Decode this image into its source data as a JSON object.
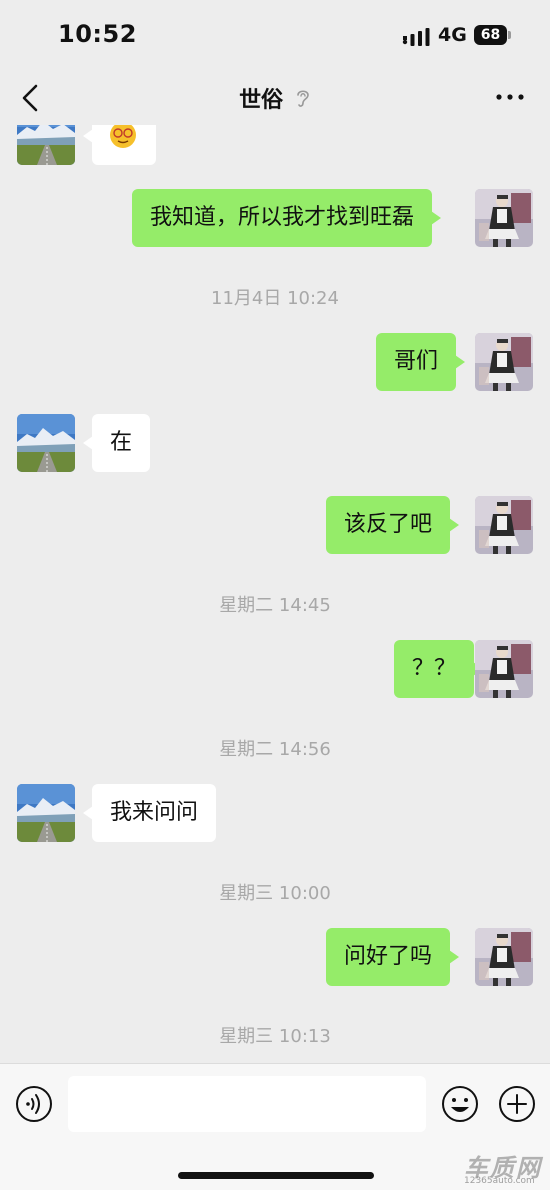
{
  "status_bar": {
    "time": "10:52",
    "network": "4G",
    "battery": "68"
  },
  "header": {
    "title": "世俗",
    "back_icon": "chevron-left-icon",
    "mute_icon": "ear-muted-icon",
    "more_icon": "ellipsis-icon"
  },
  "messages": [
    {
      "side": "in",
      "type": "sticker",
      "sticker": "yellow-face-sticker"
    },
    {
      "side": "out",
      "type": "text",
      "text": "我知道，所以我才找到旺磊"
    },
    {
      "type": "time",
      "text": "11月4日 10:24"
    },
    {
      "side": "out",
      "type": "text",
      "text": "哥们"
    },
    {
      "side": "in",
      "type": "text",
      "text": "在"
    },
    {
      "side": "out",
      "type": "text",
      "text": "该反了吧"
    },
    {
      "type": "time",
      "text": "星期二 14:45"
    },
    {
      "side": "out",
      "type": "text",
      "text": "？？"
    },
    {
      "type": "time",
      "text": "星期二 14:56"
    },
    {
      "side": "in",
      "type": "text",
      "text": "我来问问"
    },
    {
      "type": "time",
      "text": "星期三 10:00"
    },
    {
      "side": "out",
      "type": "text",
      "text": "问好了吗"
    },
    {
      "type": "time",
      "text": "星期三 10:13"
    }
  ],
  "watermark_mid": "12365auto.com",
  "input_bar": {
    "placeholder": "",
    "voice_icon": "voice-icon",
    "emoji_icon": "emoji-icon",
    "plus_icon": "plus-icon"
  },
  "brand": {
    "logo_text": "车质网",
    "url": "12365auto.com"
  },
  "colors": {
    "background": "#ededed",
    "outgoing_bubble": "#95ec69",
    "incoming_bubble": "#ffffff",
    "timestamp": "#a8a8a8"
  }
}
